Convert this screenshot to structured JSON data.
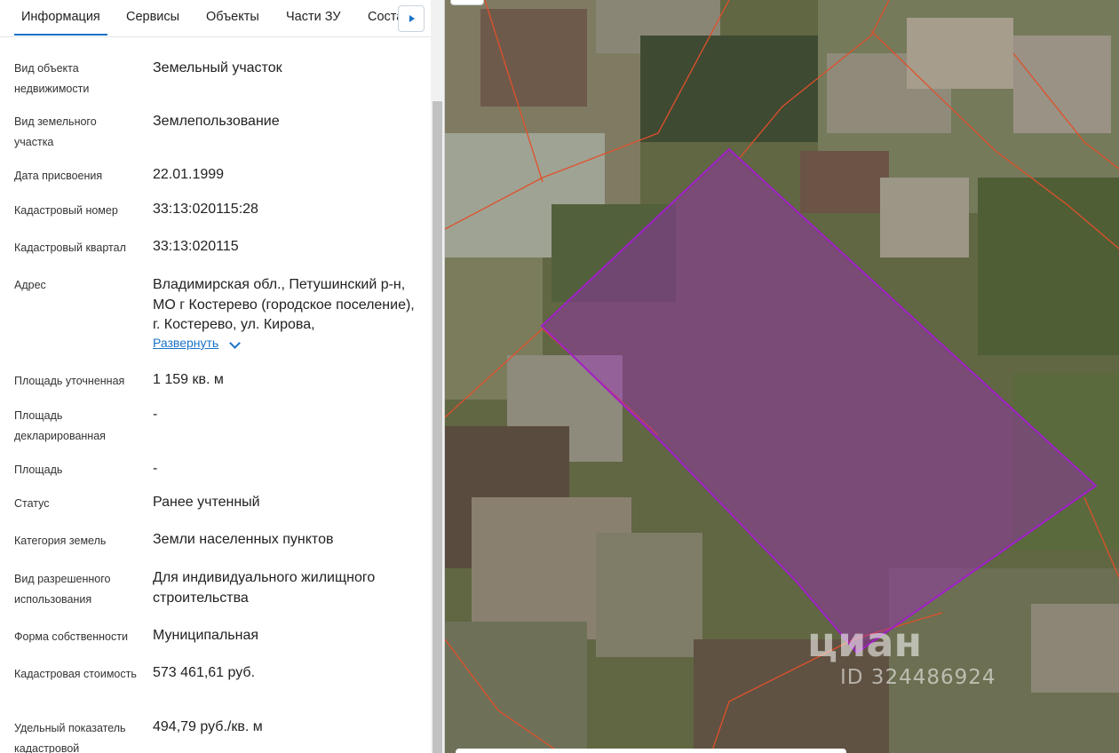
{
  "tabs": [
    {
      "label": "Информация",
      "active": true
    },
    {
      "label": "Сервисы"
    },
    {
      "label": "Объекты"
    },
    {
      "label": "Части ЗУ"
    },
    {
      "label": "Соста"
    }
  ],
  "properties": [
    {
      "label": "Вид объекта недвижимости",
      "value": "Земельный участок"
    },
    {
      "label": "Вид земельного участка",
      "value": "Землепользование"
    },
    {
      "label": "Дата присвоения",
      "value": "22.01.1999"
    },
    {
      "label": "Кадастровый номер",
      "value": "33:13:020115:28"
    },
    {
      "label": "Кадастровый квартал",
      "value": "33:13:020115"
    },
    {
      "label": "Адрес",
      "value": "Владимирская обл., Петушинский р-н, МО г Костерево (городское поселение), г. Костерево, ул. Кирова,"
    },
    {
      "label": "Площадь уточненная",
      "value": "1 159 кв. м"
    },
    {
      "label": "Площадь декларированная",
      "value": "-"
    },
    {
      "label": "Площадь",
      "value": "-"
    },
    {
      "label": "Статус",
      "value": "Ранее учтенный"
    },
    {
      "label": "Категория земель",
      "value": "Земли населенных пунктов"
    },
    {
      "label": "Вид разрешенного использования",
      "value": "Для индивидуального жилищного строительства"
    },
    {
      "label": "Форма собственности",
      "value": "Муниципальная"
    },
    {
      "label": "Кадастровая стоимость",
      "value": "573 461,61 руб."
    },
    {
      "label": "Удельный показатель кадастровой",
      "value": "494,79 руб./кв. м"
    }
  ],
  "address_expand_label": "Развернуть",
  "map": {
    "watermark_brand": "циан",
    "watermark_id": "ID 324486924",
    "parcel_color": "#a020c8",
    "boundary_color": "#e0502a"
  }
}
